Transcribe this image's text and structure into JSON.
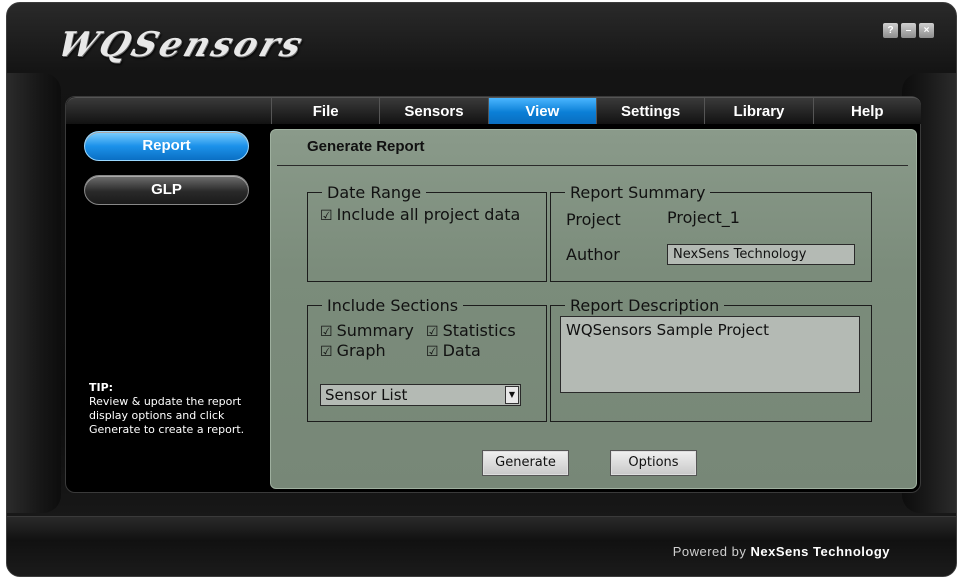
{
  "app": {
    "logo": "WQSensors",
    "window_controls": [
      "?",
      "–",
      "×"
    ]
  },
  "tabs": [
    {
      "label": "File",
      "active": false
    },
    {
      "label": "Sensors",
      "active": false
    },
    {
      "label": "View",
      "active": true
    },
    {
      "label": "Settings",
      "active": false
    },
    {
      "label": "Library",
      "active": false
    },
    {
      "label": "Help",
      "active": false
    }
  ],
  "sidenav": {
    "items": [
      {
        "label": "Report",
        "active": true
      },
      {
        "label": "GLP",
        "active": false
      }
    ]
  },
  "tip": {
    "title": "TIP:",
    "text": "Review & update the report display options and click Generate to create a report."
  },
  "panel": {
    "title": "Generate Report",
    "date_range": {
      "legend": "Date Range",
      "include_all_label": "Include all project data",
      "include_all_checked": true
    },
    "report_summary": {
      "legend": "Report Summary",
      "project_label": "Project",
      "project_value": "Project_1",
      "author_label": "Author",
      "author_value": "NexSens Technology"
    },
    "include_sections": {
      "legend": "Include Sections",
      "options": [
        {
          "label": "Summary",
          "checked": true
        },
        {
          "label": "Statistics",
          "checked": true
        },
        {
          "label": "Graph",
          "checked": true
        },
        {
          "label": "Data",
          "checked": true
        }
      ],
      "dropdown_value": "Sensor List"
    },
    "report_description": {
      "legend": "Report Description",
      "value": "WQSensors Sample Project"
    },
    "buttons": {
      "generate": "Generate",
      "options": "Options"
    }
  },
  "footer": {
    "powered_prefix": "Powered by",
    "powered_brand": "NexSens Technology"
  },
  "colors": {
    "active_tab": "#0b7fd6",
    "panel_green": "#7b8c7b",
    "background": "#000000"
  },
  "icons": {
    "checkbox": "checkbox-checked-icon",
    "dropdown": "chevron-down-icon"
  }
}
